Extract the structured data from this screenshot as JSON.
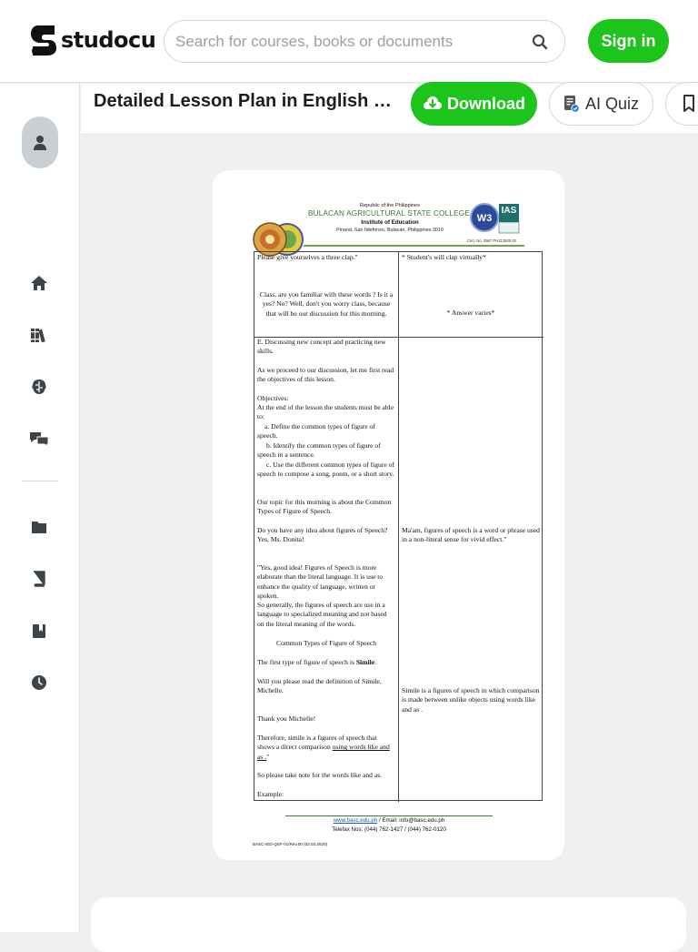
{
  "header": {
    "brand": "studocu",
    "search_placeholder": "Search for courses, books or documents",
    "signin_label": "Sign in"
  },
  "sidebar": {
    "items": [
      "home-icon",
      "library-icon",
      "ai-brain-icon",
      "chat-icon",
      "folder-icon",
      "book-icon",
      "bookmark-book-icon",
      "history-icon"
    ]
  },
  "docbar": {
    "title": "Detailed Lesson Plan in English 7 Typ...",
    "download_label": "Download",
    "quiz_label": "AI Quiz"
  },
  "document": {
    "republic": "Republic of the Philippines",
    "college": "BULACAN AGRICULTURAL STATE COLLEGE",
    "institute": "Institute of Education",
    "address": "Pinaod, San Ildefonso, Bulacan, Philippines 3010",
    "cert": "Cert. No. 3567 PH212500.00",
    "ias": "IAS",
    "r1_left": "Please give yourselves a three clap.\"",
    "r1_right": "* Student's will clap virtually*",
    "r2_left": "Class, are you familiar with these words ? Is it a yes? No? Well, don't you worry class, because that will be our discussion for this morning.",
    "r2_right": "* Answer varies*",
    "e_heading": "E. Discussing new concept and practicing new skills.",
    "proceed": "As we proceed to our discussion, let  me first read the objectives of this lesson.",
    "objectives": "Objectives:",
    "obj_intro": "At the end of the lesson the students must be able to:",
    "obj_a": "a.  Define the common types of  figure of speech.",
    "obj_b": "b. Identify the common types of  figure of speech in a sentence.",
    "obj_c": "c. Use the different common types of figure of speech to compose a song, poem, or a short story.",
    "topic": "Our topic for this morning is about the Common Types of Figure of Speech.",
    "idea": "Do you have any idea about figures of Speech?  Yes, Ms. Donita!",
    "answer_donita": "Ma'am, figures of speech is a word or phrase used in a non-literal sense for vivid effect.\"",
    "good_idea": "\"Yes, good idea! Figures of Speech is more elaborate than the literal language. It is use to enhance the quality of language, written or spoken.",
    "so_generally": "So generally, the figures of speech are use in a language to specialized meaning and not based on the literal meaning of the words.",
    "common_types": "Common Types of Figure of Speech",
    "first_type_pre": "The first type of figure of speech is ",
    "first_type_bold": "Simile",
    "first_type_post": ".",
    "read_def": "Will you please read the definition of Simile, Michelle.",
    "simile_def": "Simile is a figures of speech in  which comparison is made between unlike objects using words like and as .",
    "thanks": "Thank you Michelle!",
    "therefore_pre": "Therefore, simile is a figures of speech that shows a direct comparison ",
    "therefore_u": "using words like and as .",
    "therefore_post": "\"",
    "take_note": "So please take note for the words like and as.",
    "example": "Example:",
    "web": "www.basc.edu.ph",
    "email": "  /  Email: info@basc.edu.ph",
    "telefax": "Telefax Nos: (044) 762-1427  /  (044) 762-0120",
    "form_code": "BASC-IED-QSF-01/Rev.00 (02.03.2020)"
  },
  "colors": {
    "accent": "#1cc41c",
    "college_green": "#2e7d32",
    "link_blue": "#1a56c4"
  }
}
